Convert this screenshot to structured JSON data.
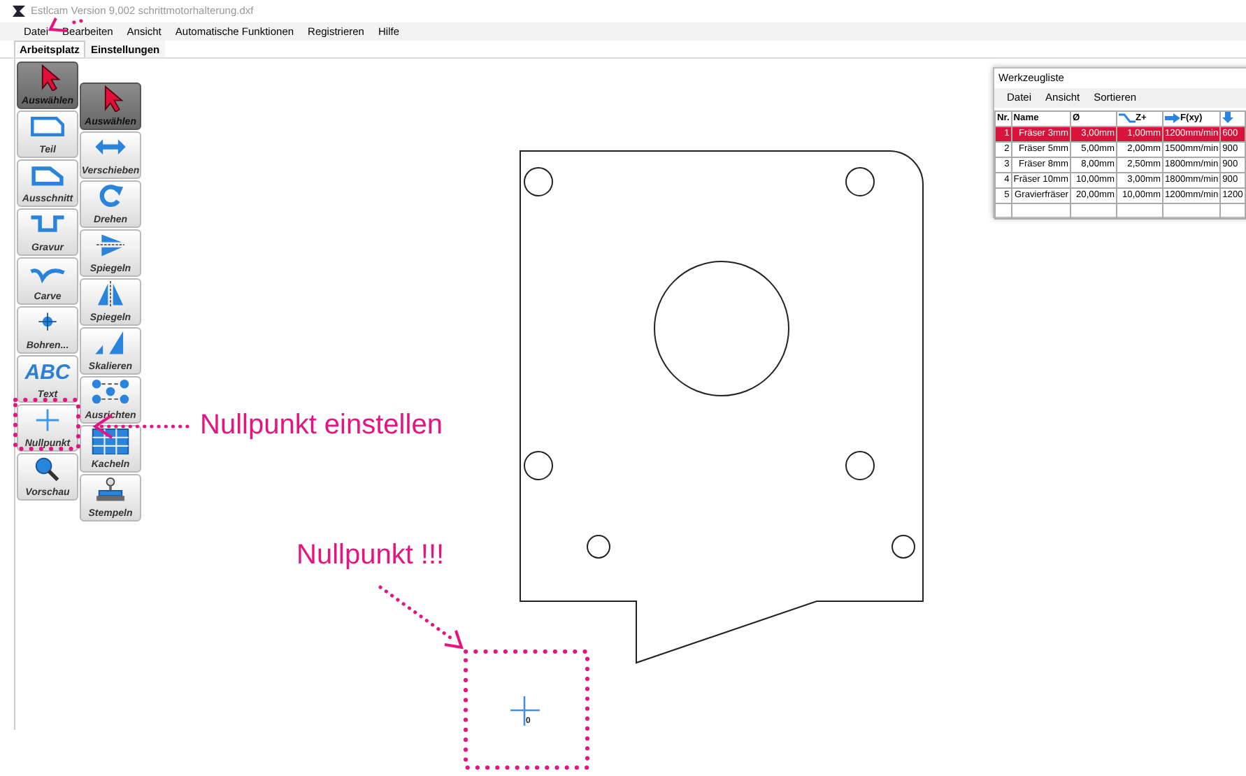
{
  "window": {
    "title": "Estlcam Version 9,002 schrittmotorhalterung.dxf"
  },
  "menu": [
    "Datei",
    "Bearbeiten",
    "Ansicht",
    "Automatische Funktionen",
    "Registrieren",
    "Hilfe"
  ],
  "tabs": [
    {
      "label": "Arbeitsplatz",
      "selected": true
    },
    {
      "label": "Einstellungen",
      "selected": false
    }
  ],
  "tools_primary": [
    {
      "label": "Auswählen",
      "selected": true
    },
    {
      "label": "Teil",
      "selected": false
    },
    {
      "label": "Ausschnitt",
      "selected": false
    },
    {
      "label": "Gravur",
      "selected": false
    },
    {
      "label": "Carve",
      "selected": false
    },
    {
      "label": "Bohren...",
      "selected": false
    },
    {
      "label": "Text",
      "selected": false,
      "glyph": "ABC"
    },
    {
      "label": "Nullpunkt",
      "selected": false
    },
    {
      "label": "Vorschau",
      "selected": false
    }
  ],
  "tools_secondary": [
    {
      "label": "Auswählen",
      "selected": true
    },
    {
      "label": "Verschieben",
      "selected": false
    },
    {
      "label": "Drehen",
      "selected": false
    },
    {
      "label": "Spiegeln",
      "selected": false
    },
    {
      "label": "Spiegeln",
      "selected": false
    },
    {
      "label": "Skalieren",
      "selected": false
    },
    {
      "label": "Ausrichten",
      "selected": false
    },
    {
      "label": "Kacheln",
      "selected": false
    },
    {
      "label": "Stempeln",
      "selected": false
    }
  ],
  "tool_list": {
    "title": "Werkzeugliste",
    "menu": [
      "Datei",
      "Ansicht",
      "Sortieren"
    ],
    "columns": [
      "Nr.",
      "Name",
      "Ø",
      "Z+",
      "F(xy)"
    ],
    "rows": [
      {
        "cells": [
          "1",
          "Fräser 3mm",
          "3,00mm",
          "1,00mm",
          "1200mm/min",
          "600"
        ],
        "selected": true
      },
      {
        "cells": [
          "2",
          "Fräser 5mm",
          "5,00mm",
          "2,00mm",
          "1500mm/min",
          "900"
        ],
        "selected": false
      },
      {
        "cells": [
          "3",
          "Fräser 8mm",
          "8,00mm",
          "2,50mm",
          "1800mm/min",
          "900"
        ],
        "selected": false
      },
      {
        "cells": [
          "4",
          "Fräser 10mm",
          "10,00mm",
          "3,00mm",
          "1800mm/min",
          "900"
        ],
        "selected": false
      },
      {
        "cells": [
          "5",
          "Gravierfräser",
          "20,00mm",
          "10,00mm",
          "1200mm/min",
          "1200"
        ],
        "selected": false
      }
    ]
  },
  "origin": {
    "label": "0"
  },
  "annotations": [
    {
      "text": "Nullpunkt einstellen"
    },
    {
      "text": "Nullpunkt !!!"
    }
  ]
}
